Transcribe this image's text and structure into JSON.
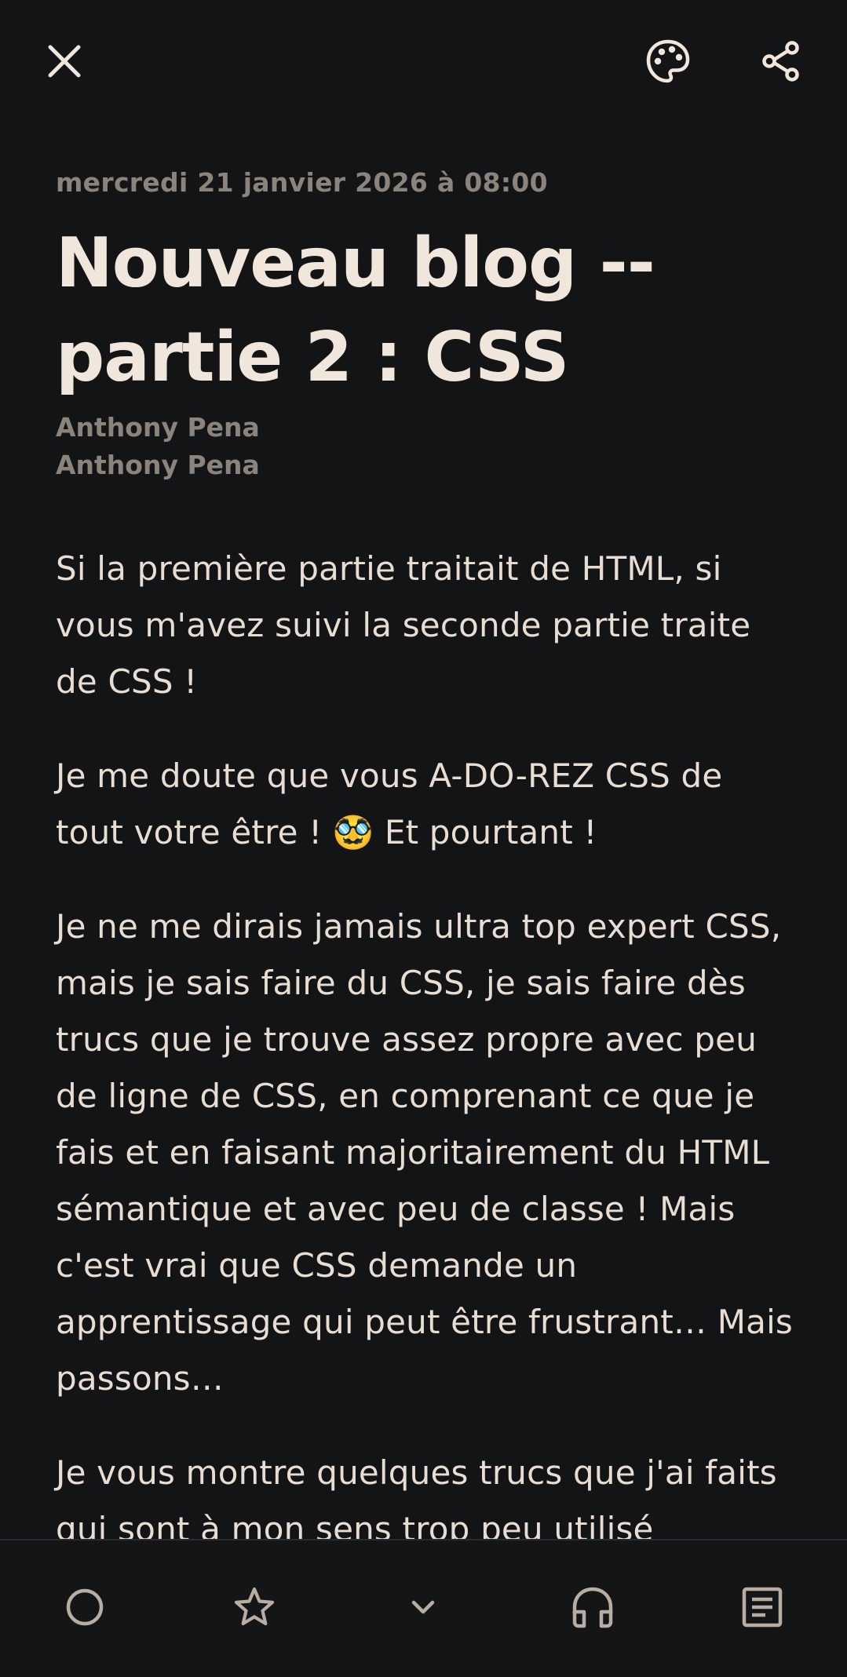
{
  "topbar": {
    "close_icon": "close-icon",
    "palette_icon": "palette-icon",
    "share_icon": "share-icon"
  },
  "article": {
    "date": "mercredi 21 janvier 2026 à 08:00",
    "title_line1": "Nouveau blog --",
    "title_line2": "partie 2 : CSS",
    "authors": [
      "Anthony Pena",
      "Anthony Pena"
    ],
    "paragraphs": [
      "Si la première partie traitait de HTML, si vous m'avez suivi la seconde partie traite de CSS !",
      "Je me doute que vous A-DO-REZ CSS de tout votre être ! 🥸 Et pourtant !",
      "Je ne me dirais jamais ultra top expert CSS, mais je sais faire du CSS, je sais faire dès trucs que je trouve assez propre avec peu de ligne de CSS, en comprenant ce que je fais et en faisant majoritairement du HTML sémantique et avec peu de classe ! Mais c'est vrai que CSS demande un apprentissage qui peut être frustrant… Mais passons…",
      "Je vous montre quelques trucs que j'ai faits qui sont à mon sens trop peu utilisé"
    ]
  },
  "bottombar": {
    "items": [
      {
        "icon": "circle-icon"
      },
      {
        "icon": "star-icon"
      },
      {
        "icon": "chevron-down-icon"
      },
      {
        "icon": "headphones-icon"
      },
      {
        "icon": "article-icon"
      }
    ]
  },
  "colors": {
    "background": "#131416",
    "text": "#e8ddd2",
    "muted": "#8a847c",
    "icon": "#f1e6dc",
    "nav_icon": "#b8ada2"
  }
}
